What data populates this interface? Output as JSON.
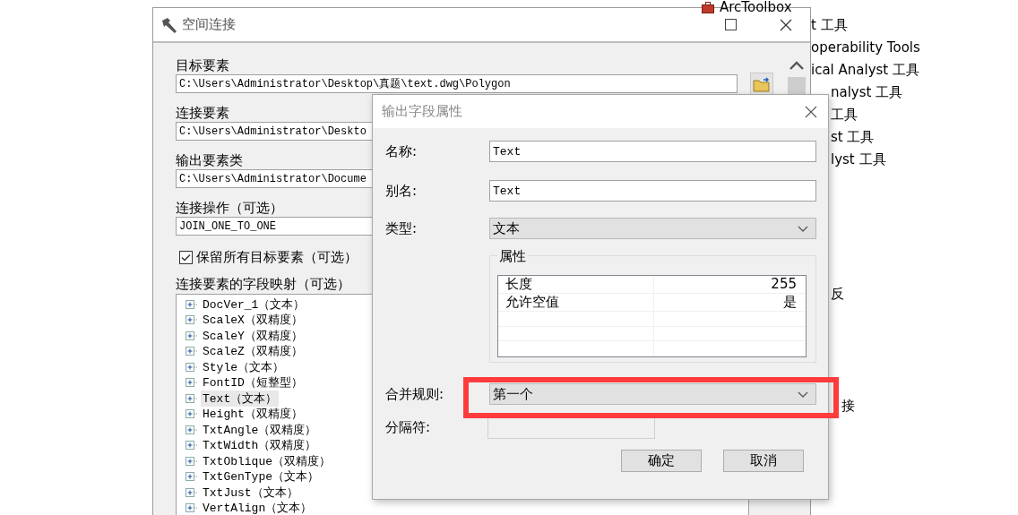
{
  "background_toolbox": {
    "header": "ArcToolbox",
    "items": [
      "t 工具",
      "operability Tools",
      "ical Analyst 工具",
      "nalyst 工具",
      "工具",
      "st 工具",
      "lyst 工具"
    ],
    "lower_items": [
      "反",
      "接"
    ]
  },
  "main_window": {
    "title": "空间连接",
    "fields": [
      {
        "label": "目标要素",
        "value": "C:\\Users\\Administrator\\Desktop\\真题\\text.dwg\\Polygon"
      },
      {
        "label": "连接要素",
        "value": "C:\\Users\\Administrator\\Deskto"
      },
      {
        "label": "输出要素类",
        "value": "C:\\Users\\Administrator\\Docume"
      },
      {
        "label": "连接操作（可选）",
        "value": "JOIN_ONE_TO_ONE"
      }
    ],
    "keep_all": {
      "label": "保留所有目标要素（可选）",
      "checked": true
    },
    "field_map": {
      "label": "连接要素的字段映射（可选）",
      "items": [
        {
          "text": "DocVer_1（文本）",
          "selected": false
        },
        {
          "text": "ScaleX（双精度）",
          "selected": false
        },
        {
          "text": "ScaleY（双精度）",
          "selected": false
        },
        {
          "text": "ScaleZ（双精度）",
          "selected": false
        },
        {
          "text": "Style（文本）",
          "selected": false
        },
        {
          "text": "FontID（短整型）",
          "selected": false
        },
        {
          "text": "Text（文本）",
          "selected": true
        },
        {
          "text": "Height（双精度）",
          "selected": false
        },
        {
          "text": "TxtAngle（双精度）",
          "selected": false
        },
        {
          "text": "TxtWidth（双精度）",
          "selected": false
        },
        {
          "text": "TxtOblique（双精度）",
          "selected": false
        },
        {
          "text": "TxtGenType（文本）",
          "selected": false
        },
        {
          "text": "TxtJust（文本）",
          "selected": false
        },
        {
          "text": "VertAlign（文本）",
          "selected": false
        }
      ]
    }
  },
  "dialog": {
    "title": "输出字段属性",
    "name": {
      "label": "名称:",
      "value": "Text"
    },
    "alias": {
      "label": "别名:",
      "value": "Text"
    },
    "type": {
      "label": "类型:",
      "value": "文本"
    },
    "properties": {
      "label": "属性",
      "rows": [
        {
          "name": "长度",
          "value": "255"
        },
        {
          "name": "允许空值",
          "value": "是"
        }
      ]
    },
    "merge_rule": {
      "label": "合并规则:",
      "value": "第一个",
      "highlighted": true
    },
    "delimiter": {
      "label": "分隔符:",
      "disabled": true
    },
    "buttons": [
      "确定",
      "取消"
    ]
  }
}
